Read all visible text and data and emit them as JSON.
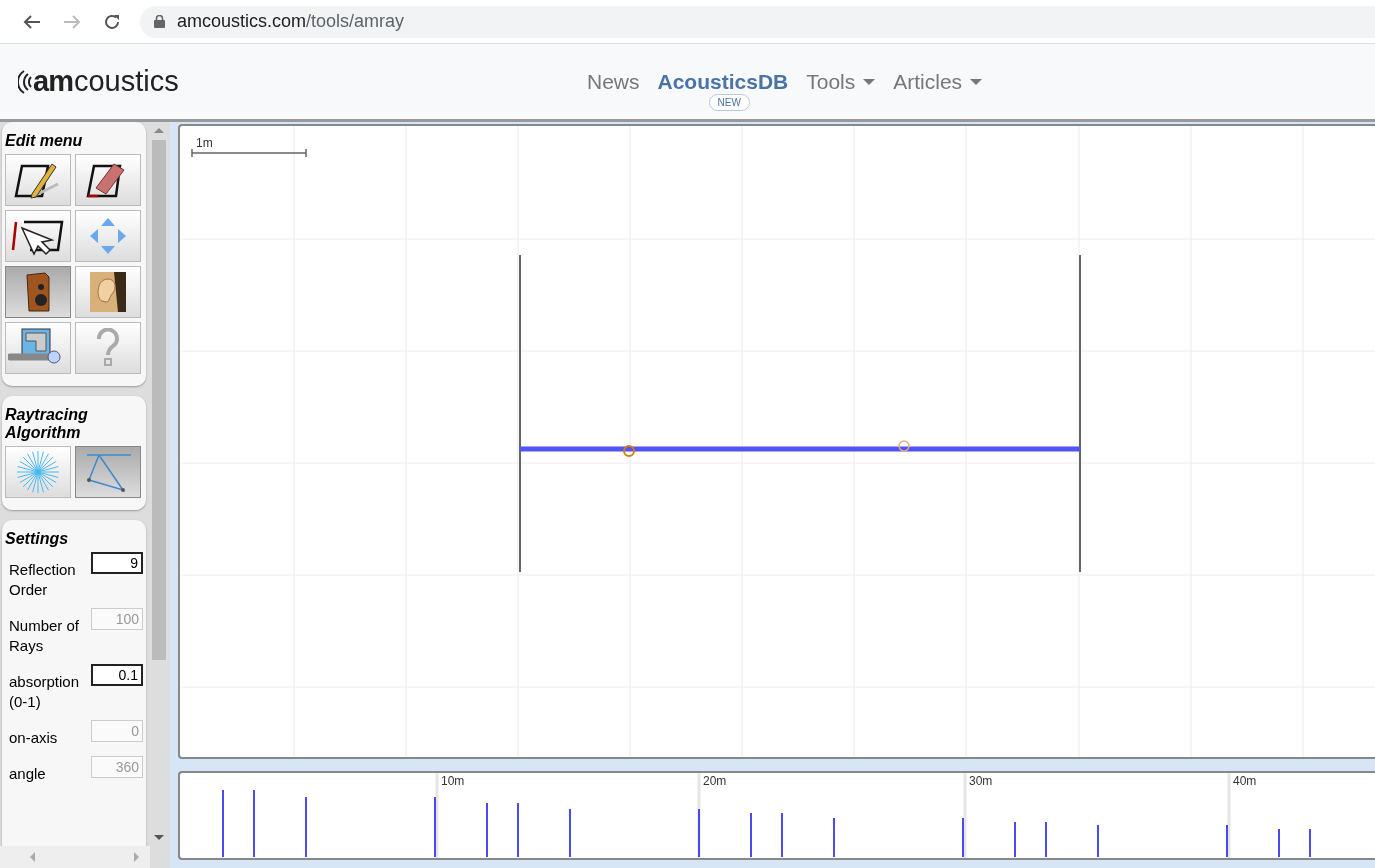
{
  "browser": {
    "url_host": "amcoustics.com",
    "url_path": "/tools/amray"
  },
  "header": {
    "logo_prefix": "am",
    "logo_suffix": "coustics",
    "nav": [
      {
        "label": "News",
        "selected": false,
        "dropdown": false
      },
      {
        "label": "AcousticsDB",
        "selected": true,
        "dropdown": false,
        "badge": "NEW"
      },
      {
        "label": "Tools",
        "selected": false,
        "dropdown": true
      },
      {
        "label": "Articles",
        "selected": false,
        "dropdown": true
      }
    ]
  },
  "edit_menu": {
    "title": "Edit menu",
    "tools": [
      {
        "kind": "draw",
        "selected": false
      },
      {
        "kind": "erase",
        "selected": false
      },
      {
        "kind": "select",
        "selected": false
      },
      {
        "kind": "move",
        "selected": false
      },
      {
        "kind": "source",
        "selected": true
      },
      {
        "kind": "receiver",
        "selected": false
      },
      {
        "kind": "settings",
        "selected": false
      },
      {
        "kind": "help",
        "selected": false
      }
    ]
  },
  "algorithm": {
    "title": "Raytracing Algorithm",
    "options": [
      {
        "kind": "rays",
        "selected": false
      },
      {
        "kind": "image",
        "selected": true
      }
    ]
  },
  "settings": {
    "title": "Settings",
    "fields": [
      {
        "label": "Reflection Order",
        "value": "9",
        "disabled": false
      },
      {
        "label": "Number of Rays",
        "value": "100",
        "disabled": true
      },
      {
        "label": "absorption (0-1)",
        "value": "0.1",
        "disabled": false
      },
      {
        "label": "on-axis",
        "value": "0",
        "disabled": true
      },
      {
        "label": "angle",
        "value": "360",
        "disabled": true
      }
    ]
  },
  "canvas": {
    "scale_label": "1m"
  },
  "echogram": {
    "ticks": [
      "10m",
      "20m",
      "30m",
      "40m"
    ]
  }
}
